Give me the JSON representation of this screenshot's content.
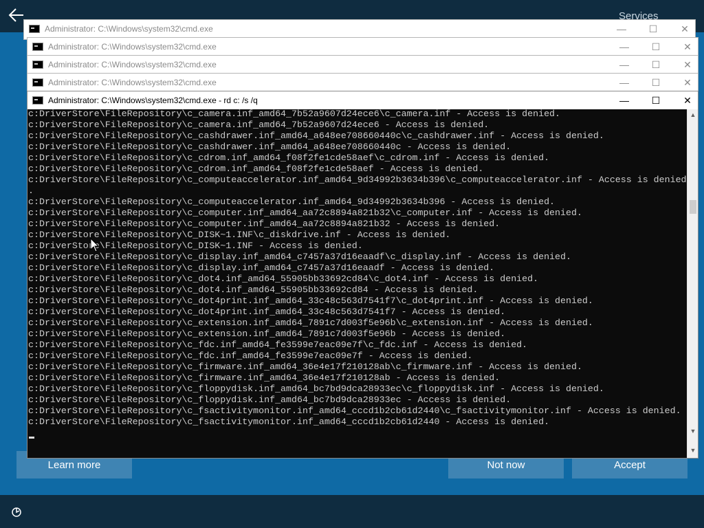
{
  "oobe": {
    "top_right_label": "Services",
    "learn_more": "Learn more",
    "not_now": "Not now",
    "accept": "Accept"
  },
  "windows": [
    {
      "title": "Administrator: C:\\Windows\\system32\\cmd.exe"
    },
    {
      "title": "Administrator: C:\\Windows\\system32\\cmd.exe"
    },
    {
      "title": "Administrator: C:\\Windows\\system32\\cmd.exe"
    },
    {
      "title": "Administrator: C:\\Windows\\system32\\cmd.exe"
    }
  ],
  "active_window": {
    "title": "Administrator: C:\\Windows\\system32\\cmd.exe - rd  c: /s /q",
    "lines": [
      "c:DriverStore\\FileRepository\\c_camera.inf_amd64_7b52a9607d24ece6\\c_camera.inf - Access is denied.",
      "c:DriverStore\\FileRepository\\c_camera.inf_amd64_7b52a9607d24ece6 - Access is denied.",
      "c:DriverStore\\FileRepository\\c_cashdrawer.inf_amd64_a648ee708660440c\\c_cashdrawer.inf - Access is denied.",
      "c:DriverStore\\FileRepository\\c_cashdrawer.inf_amd64_a648ee708660440c - Access is denied.",
      "c:DriverStore\\FileRepository\\c_cdrom.inf_amd64_f08f2fe1cde58aef\\c_cdrom.inf - Access is denied.",
      "c:DriverStore\\FileRepository\\c_cdrom.inf_amd64_f08f2fe1cde58aef - Access is denied.",
      "c:DriverStore\\FileRepository\\c_computeaccelerator.inf_amd64_9d34992b3634b396\\c_computeaccelerator.inf - Access is denied",
      ".",
      "c:DriverStore\\FileRepository\\c_computeaccelerator.inf_amd64_9d34992b3634b396 - Access is denied.",
      "c:DriverStore\\FileRepository\\c_computer.inf_amd64_aa72c8894a821b32\\c_computer.inf - Access is denied.",
      "c:DriverStore\\FileRepository\\c_computer.inf_amd64_aa72c8894a821b32 - Access is denied.",
      "c:DriverStore\\FileRepository\\C_DISK~1.INF\\c_diskdrive.inf - Access is denied.",
      "c:DriverStore\\FileRepository\\C_DISK~1.INF - Access is denied.",
      "c:DriverStore\\FileRepository\\c_display.inf_amd64_c7457a37d16eaadf\\c_display.inf - Access is denied.",
      "c:DriverStore\\FileRepository\\c_display.inf_amd64_c7457a37d16eaadf - Access is denied.",
      "c:DriverStore\\FileRepository\\c_dot4.inf_amd64_55905bb33692cd84\\c_dot4.inf - Access is denied.",
      "c:DriverStore\\FileRepository\\c_dot4.inf_amd64_55905bb33692cd84 - Access is denied.",
      "c:DriverStore\\FileRepository\\c_dot4print.inf_amd64_33c48c563d7541f7\\c_dot4print.inf - Access is denied.",
      "c:DriverStore\\FileRepository\\c_dot4print.inf_amd64_33c48c563d7541f7 - Access is denied.",
      "c:DriverStore\\FileRepository\\c_extension.inf_amd64_7891c7d003f5e96b\\c_extension.inf - Access is denied.",
      "c:DriverStore\\FileRepository\\c_extension.inf_amd64_7891c7d003f5e96b - Access is denied.",
      "c:DriverStore\\FileRepository\\c_fdc.inf_amd64_fe3599e7eac09e7f\\c_fdc.inf - Access is denied.",
      "c:DriverStore\\FileRepository\\c_fdc.inf_amd64_fe3599e7eac09e7f - Access is denied.",
      "c:DriverStore\\FileRepository\\c_firmware.inf_amd64_36e4e17f210128ab\\c_firmware.inf - Access is denied.",
      "c:DriverStore\\FileRepository\\c_firmware.inf_amd64_36e4e17f210128ab - Access is denied.",
      "c:DriverStore\\FileRepository\\c_floppydisk.inf_amd64_bc7bd9dca28933ec\\c_floppydisk.inf - Access is denied.",
      "c:DriverStore\\FileRepository\\c_floppydisk.inf_amd64_bc7bd9dca28933ec - Access is denied.",
      "c:DriverStore\\FileRepository\\c_fsactivitymonitor.inf_amd64_cccd1b2cb61d2440\\c_fsactivitymonitor.inf - Access is denied.",
      "c:DriverStore\\FileRepository\\c_fsactivitymonitor.inf_amd64_cccd1b2cb61d2440 - Access is denied."
    ]
  },
  "window_controls": {
    "minimize": "—",
    "maximize": "☐",
    "close": "✕"
  },
  "colors": {
    "oobe_blue": "#0f6aa5",
    "dark_bar": "#0f2c40",
    "console_bg": "#0c0c0c",
    "console_text": "#cccccc"
  }
}
